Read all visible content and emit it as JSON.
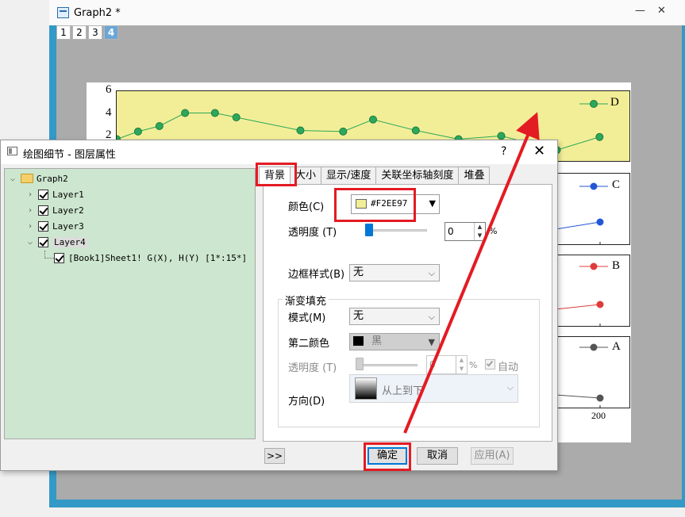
{
  "graph_window": {
    "title": "Graph2 *",
    "minimize_glyph": "—",
    "close_glyph": "✕",
    "page_tabs": [
      "1",
      "2",
      "3",
      "4"
    ],
    "active_page_tab": "4"
  },
  "graph": {
    "layers": [
      {
        "name": "D",
        "color": "#2ca85a",
        "background": "#f2ee97"
      },
      {
        "name": "C",
        "color": "#2457d6",
        "background": "#ffffff"
      },
      {
        "name": "B",
        "color": "#e03b3b",
        "background": "#ffffff"
      },
      {
        "name": "A",
        "color": "#555555",
        "background": "#ffffff"
      }
    ],
    "yticks_layer4": [
      "6",
      "4",
      "2"
    ],
    "xtick_bottom": "200",
    "series_D_points": [
      [
        0.0,
        2.0
      ],
      [
        0.5,
        2.7
      ],
      [
        1.0,
        3.2
      ],
      [
        1.6,
        4.4
      ],
      [
        2.3,
        4.4
      ],
      [
        2.8,
        4.0
      ],
      [
        4.3,
        2.8
      ],
      [
        5.3,
        2.7
      ],
      [
        6.0,
        3.8
      ],
      [
        7.0,
        2.8
      ],
      [
        8.0,
        2.0
      ],
      [
        9.0,
        2.3
      ],
      [
        10.3,
        1.0
      ],
      [
        11.3,
        2.2
      ]
    ]
  },
  "dialog": {
    "title": "绘图细节 - 图层属性",
    "help_glyph": "?",
    "close_glyph": "✕",
    "tree": {
      "root": "Graph2",
      "layers": [
        "Layer1",
        "Layer2",
        "Layer3",
        "Layer4"
      ],
      "selected_layer": "Layer4",
      "plot_item": "[Book1]Sheet1! G(X), H(Y) [1*:15*]"
    },
    "tabs": [
      "背景",
      "大小",
      "显示/速度",
      "关联坐标轴刻度",
      "堆叠"
    ],
    "active_tab": "背景",
    "background_tab": {
      "color_label": "颜色(C)",
      "color_value": "#F2EE97",
      "color_swatch": "#f2ee97",
      "transparency_label": "透明度 (T)",
      "transparency_value": "0",
      "percent_sign": "%",
      "border_style_label": "边框样式(B)",
      "border_style_value": "无",
      "gradient_group_title": "渐变填充",
      "mode_label": "模式(M)",
      "mode_value": "无",
      "second_color_label": "第二颜色",
      "second_color_value": "黑",
      "second_color_swatch": "#000000",
      "gradient_transparency_label": "透明度 (T)",
      "gradient_transparency_value": "0",
      "auto_label": "自动",
      "direction_label": "方向(D)",
      "direction_value": "从上到下"
    },
    "buttons": {
      "expand": ">>",
      "ok": "确定",
      "cancel": "取消",
      "apply": "应用(A)"
    }
  },
  "annotation_color": "#e31b23"
}
